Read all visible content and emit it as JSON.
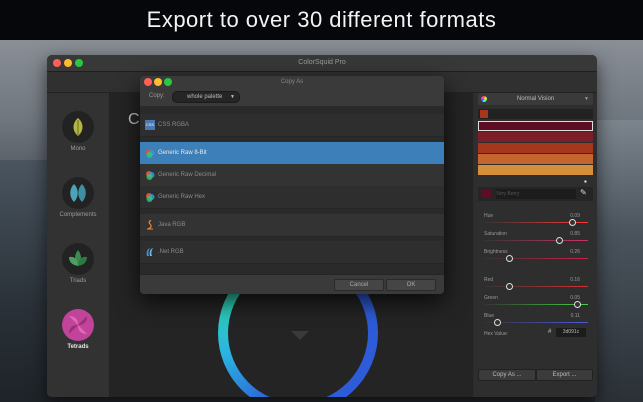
{
  "headline": "Export to over 30 different formats",
  "window": {
    "title": "ColorSquid Pro",
    "center_label": "C"
  },
  "sidebar": {
    "items": [
      {
        "label": "Mono",
        "icon": "mono-leaf-icon",
        "color": "#b5b542"
      },
      {
        "label": "Complements",
        "icon": "complements-leaf-icon",
        "color": "#4aa3b8"
      },
      {
        "label": "Triads",
        "icon": "triads-leaf-icon",
        "color": "#3c8a52"
      },
      {
        "label": "Tetrads",
        "icon": "tetrads-leaf-icon",
        "color": "#c2439a"
      }
    ]
  },
  "dialog": {
    "title": "Copy As",
    "copy_label": "Copy:",
    "copy_value": "whole palette",
    "formats": [
      {
        "label": "CSS RGBA",
        "icon": "css-icon"
      },
      {
        "label": "Generic Raw 8-Bit",
        "icon": "generic-color-icon"
      },
      {
        "label": "Generic Raw Decimal",
        "icon": "generic-color-icon"
      },
      {
        "label": "Generic Raw Hex",
        "icon": "generic-color-icon"
      },
      {
        "label": "Java RGB",
        "icon": "java-icon"
      },
      {
        "label": ".Net RGB",
        "icon": "dotnet-icon"
      }
    ],
    "cancel": "Cancel",
    "ok": "OK"
  },
  "right_panel": {
    "vision_mode": "Normal Vision",
    "swatches": [
      "#5c0f24",
      "#7a1f27",
      "#a6371f",
      "#c4652e",
      "#d38f39"
    ],
    "color_name": "Very Berry",
    "sliders": [
      {
        "label": "Hue",
        "value": "0.09",
        "track": "#ff3a3a",
        "level": 0.85
      },
      {
        "label": "Saturation",
        "value": "0.85",
        "track": "#cc3366",
        "level": 0.72
      },
      {
        "label": "Brightness",
        "value": "0.26",
        "track": "#cc2244",
        "level": 0.22
      },
      {
        "label": "Red",
        "value": "0.16",
        "track": "#d93030",
        "level": 0.22
      },
      {
        "label": "Green",
        "value": "0.05",
        "track": "#43d043",
        "level": 0.9
      },
      {
        "label": "Blue",
        "value": "0.11",
        "track": "#4a5ae0",
        "level": 0.1
      }
    ],
    "hex_label": "Hex Value:",
    "hex_value": "3d091c",
    "copy_as": "Copy As ...",
    "export": "Export ..."
  }
}
